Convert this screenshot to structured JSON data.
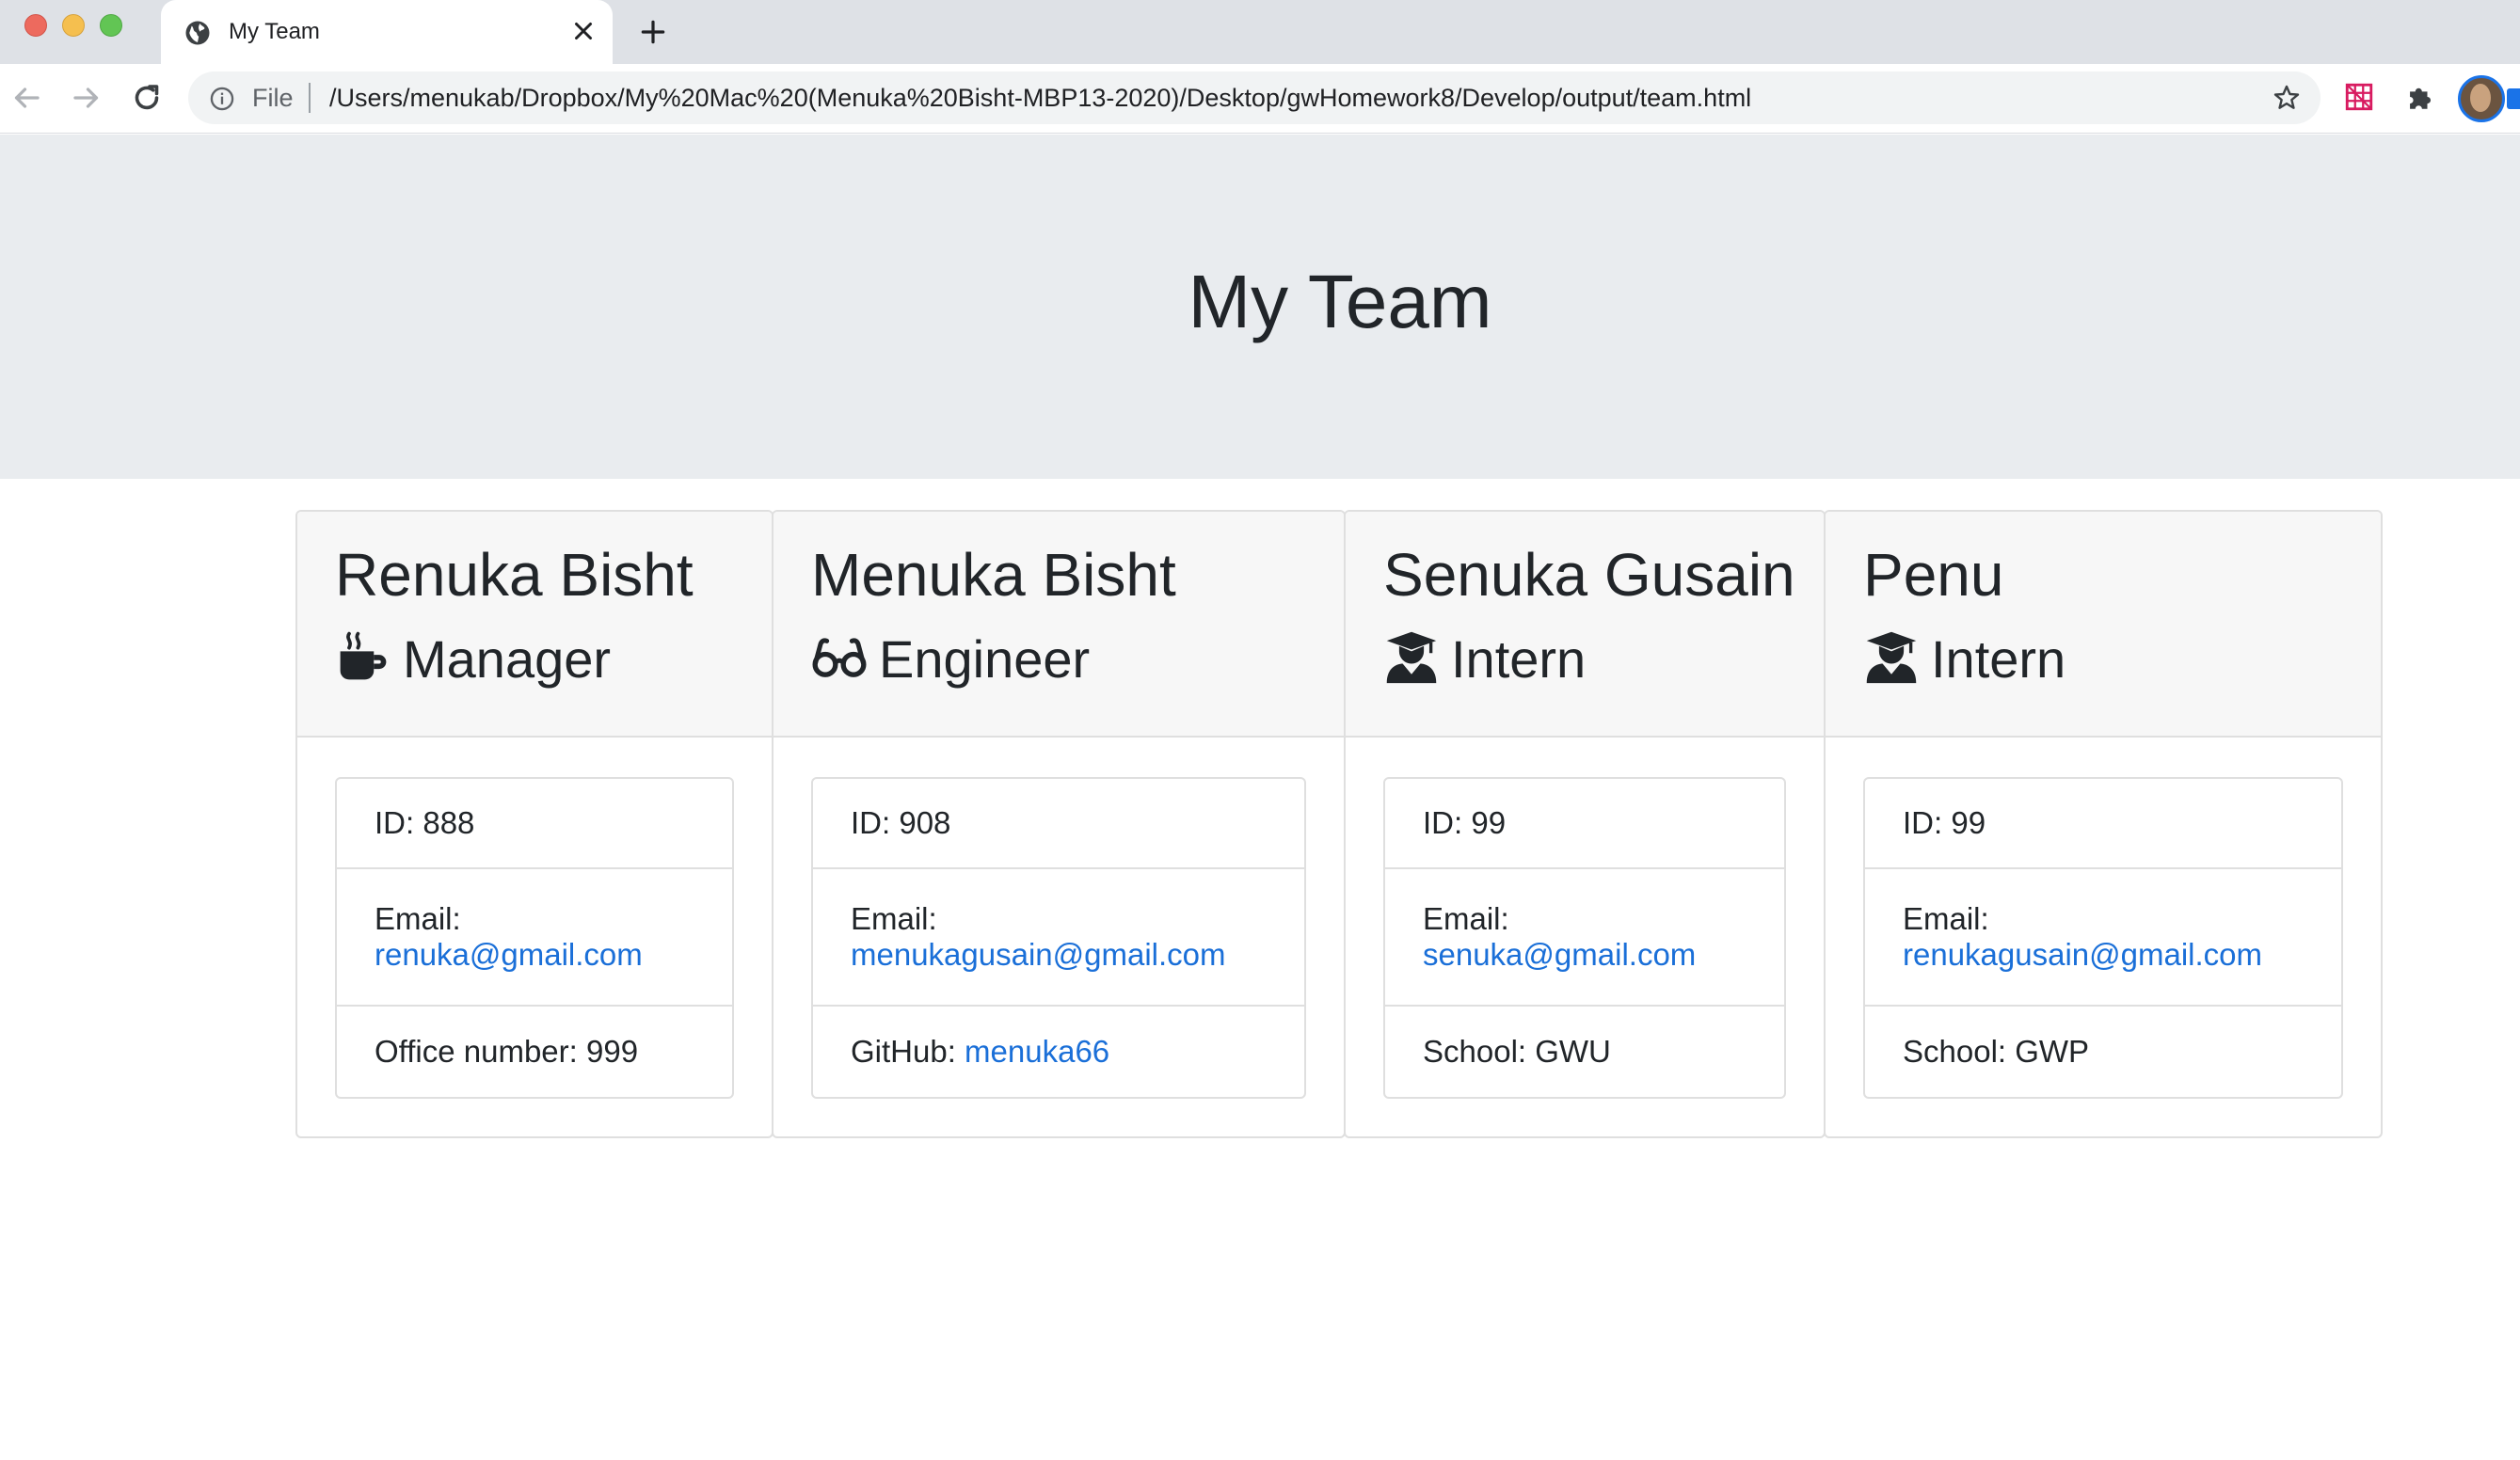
{
  "browser": {
    "tab_title": "My Team",
    "file_label": "File",
    "url": "/Users/menukab/Dropbox/My%20Mac%20(Menuka%20Bisht-MBP13-2020)/Desktop/gwHomework8/Develop/output/team.html"
  },
  "page": {
    "title": "My Team"
  },
  "team": [
    {
      "name": "Renuka Bisht",
      "role": "Manager",
      "icon": "mug-icon",
      "id_text": "ID: 888",
      "email_label": "Email:",
      "email": "renuka@gmail.com",
      "extra_label": "Office number: 999",
      "extra_link": ""
    },
    {
      "name": "Menuka Bisht",
      "role": "Engineer",
      "icon": "glasses-icon",
      "id_text": "ID: 908",
      "email_label": "Email:",
      "email": "menukagusain@gmail.com",
      "extra_label": "GitHub: ",
      "extra_link": "menuka66"
    },
    {
      "name": "Senuka Gusain",
      "role": "Intern",
      "icon": "graduate-icon",
      "id_text": "ID: 99",
      "email_label": "Email:",
      "email": "senuka@gmail.com",
      "extra_label": "School: GWU",
      "extra_link": ""
    },
    {
      "name": "Penu",
      "role": "Intern",
      "icon": "graduate-icon",
      "id_text": "ID: 99",
      "email_label": "Email:",
      "email": "renukagusain@gmail.com",
      "extra_label": "School: GWP",
      "extra_link": ""
    }
  ],
  "colors": {
    "link": "#1a6fd8",
    "jumbotron": "#e9ecef",
    "card_header": "#f7f7f7"
  }
}
